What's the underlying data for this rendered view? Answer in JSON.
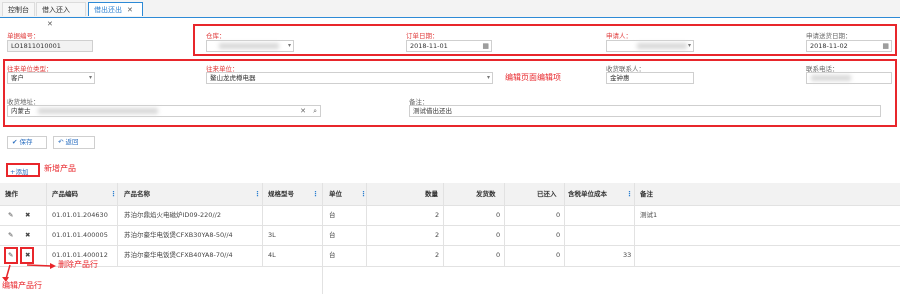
{
  "tabs": [
    {
      "label": "控制台",
      "closable": false
    },
    {
      "label": "借入还入",
      "closable": true
    },
    {
      "label": "借出还出",
      "closable": true,
      "active": true
    }
  ],
  "form": {
    "doc_no_label": "单据编号：",
    "doc_no_value": "LO1811010001",
    "warehouse_label": "仓库：",
    "order_date_label": "订单日期：",
    "order_date_value": "2018-11-01",
    "applicant_label": "申请人：",
    "return_date_label": "申请送货日期：",
    "return_date_value": "2018-11-02",
    "partner_type_label": "往来单位类型：",
    "partner_type_value": "客户",
    "partner_label": "往来单位：",
    "partner_value": "鳌山龙虎樽电器",
    "contact_label": "收货联系人：",
    "contact_value": "金钟惠",
    "phone_label": "联系电话：",
    "address_label": "收货地址：",
    "address_value": "内蒙古",
    "remark_label": "备注：",
    "remark_value": "测试借出还出"
  },
  "annotations": {
    "edit_area": "编辑页面编辑项",
    "add_product": "新增产品",
    "delete_row": "删除产品行",
    "edit_row": "编辑产品行"
  },
  "buttons": {
    "save": "保存",
    "back": "返回",
    "add": "+添加"
  },
  "table": {
    "headers": [
      "操作",
      "产品编码",
      "产品名称",
      "规格型号",
      "单位",
      "数量",
      "发货数",
      "已还入",
      "含税单位成本",
      "备注"
    ],
    "rows": [
      {
        "code": "01.01.01.204630",
        "name": "苏泊尔鼎焰火电磁炉ID09-220//2",
        "spec": "",
        "unit": "台",
        "qty": "2",
        "shipped": "0",
        "returned": "0",
        "cost": "",
        "remark": "测试1"
      },
      {
        "code": "01.01.01.400005",
        "name": "苏泊尔豪华电饭煲CFXB30YA8-50//4",
        "spec": "3L",
        "unit": "台",
        "qty": "2",
        "shipped": "0",
        "returned": "0",
        "cost": "",
        "remark": ""
      },
      {
        "code": "01.01.01.400012",
        "name": "苏泊尔豪华电饭煲CFXB40YA8-70//4",
        "spec": "4L",
        "unit": "台",
        "qty": "2",
        "shipped": "0",
        "returned": "0",
        "cost": "33",
        "remark": ""
      }
    ]
  },
  "colors": {
    "accent": "#2d8ad6",
    "annotation": "#e8262b"
  }
}
